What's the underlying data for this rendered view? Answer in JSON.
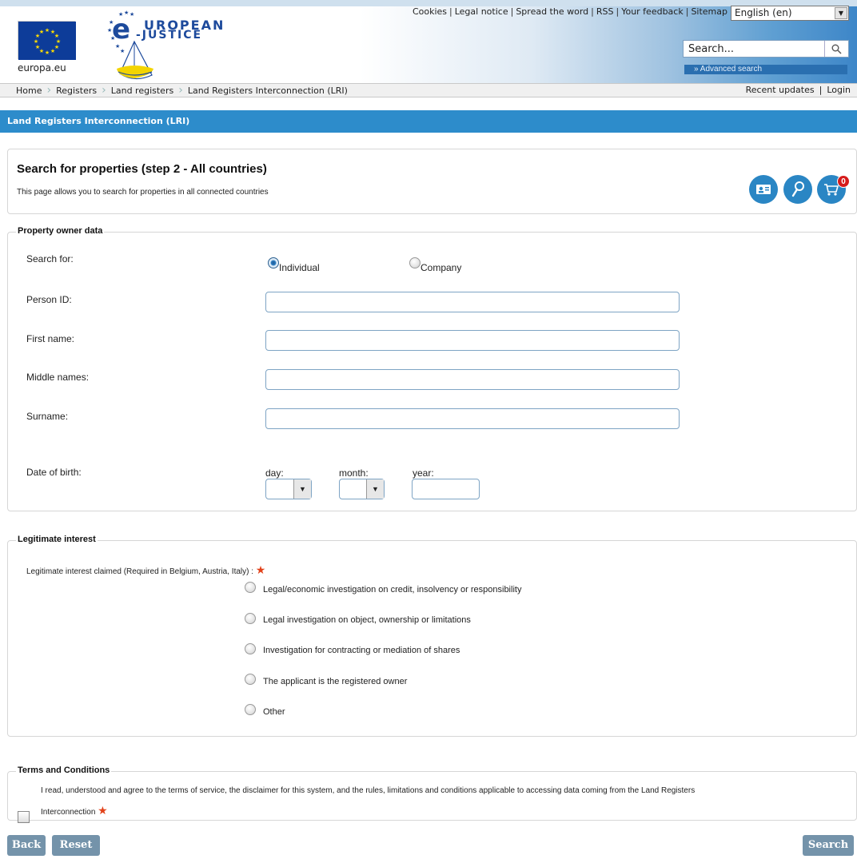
{
  "header": {
    "top_links": [
      "Cookies",
      "Legal notice",
      "Spread the word",
      "RSS",
      "Your feedback",
      "Sitemap"
    ],
    "language": "English (en)",
    "europa_label": "europa.eu",
    "logo_line1": "UROPEAN",
    "logo_line2": "-JUSTICE",
    "search_placeholder": "Search...",
    "advanced_search": "» Advanced search"
  },
  "breadcrumb": {
    "items": [
      "Home",
      "Registers",
      "Land registers",
      "Land Registers Interconnection (LRI)"
    ],
    "recent_updates": "Recent updates",
    "login": "Login"
  },
  "page_title": "Land Registers Interconnection (LRI)",
  "intro": {
    "heading": "Search for properties (step 2 - All countries)",
    "description": "This page allows you to search for properties in all connected countries",
    "cart_count": "0"
  },
  "owner": {
    "legend": "Property owner data",
    "search_for_label": "Search for:",
    "opt_individual": "Individual",
    "opt_company": "Company",
    "selected": "Individual",
    "person_id_label": "Person ID:",
    "first_name_label": "First name:",
    "middle_names_label": "Middle names:",
    "surname_label": "Surname:",
    "dob_label": "Date of birth:",
    "day_label": "day:",
    "month_label": "month:",
    "year_label": "year:"
  },
  "legitimate": {
    "legend": "Legitimate interest",
    "claim_label": "Legitimate interest claimed (Required in Belgium, Austria, Italy) :",
    "options": [
      "Legal/economic investigation on credit, insolvency or responsibility",
      "Legal investigation on object, ownership or limitations",
      "Investigation for contracting or mediation of shares",
      "The applicant is the registered owner",
      "Other"
    ]
  },
  "terms": {
    "legend": "Terms and Conditions",
    "text_line1": "I read, understood and agree to the terms of service, the disclaimer for this system, and the rules, limitations and conditions applicable to accessing data coming from the Land Registers",
    "text_line2": "Interconnection"
  },
  "buttons": {
    "back": "Back",
    "reset": "Reset",
    "search": "Search"
  },
  "colors": {
    "title_bar": "#2d8ccb",
    "button": "#7493aa",
    "required_star": "#e2421a",
    "icon_bg": "#2a86c4",
    "badge": "#d61c1c"
  }
}
